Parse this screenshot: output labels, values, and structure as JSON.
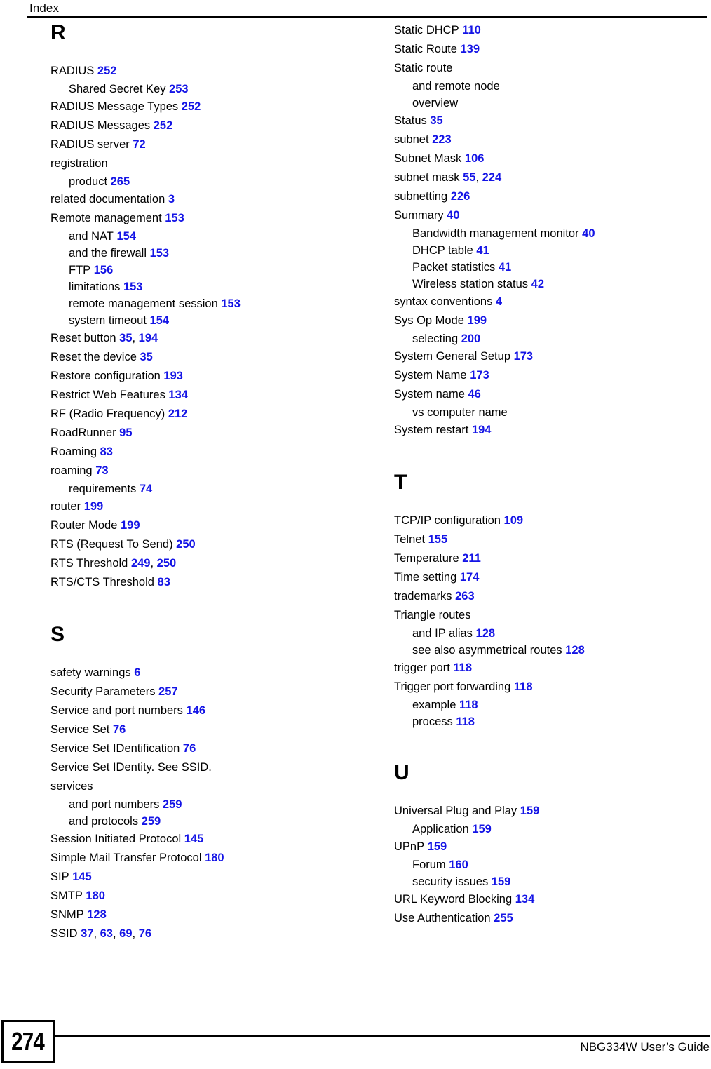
{
  "header": {
    "title": "Index"
  },
  "footer": {
    "page_number": "274",
    "guide_title": "NBG334W User’s Guide"
  },
  "colors": {
    "page_reference": "#1414E6",
    "text": "#000000",
    "background": "#FFFFFF",
    "rule": "#000000"
  },
  "columns": [
    {
      "id": "left",
      "sections": [
        {
          "letter": "R",
          "entries": [
            {
              "level": 1,
              "text": "RADIUS",
              "refs": [
                "252"
              ]
            },
            {
              "level": 2,
              "text": "Shared Secret Key",
              "refs": [
                "253"
              ]
            },
            {
              "level": 1,
              "text": "RADIUS Message Types",
              "refs": [
                "252"
              ]
            },
            {
              "level": 1,
              "text": "RADIUS Messages",
              "refs": [
                "252"
              ]
            },
            {
              "level": 1,
              "text": "RADIUS server",
              "refs": [
                "72"
              ]
            },
            {
              "level": 1,
              "text": "registration",
              "refs": []
            },
            {
              "level": 2,
              "text": "product",
              "refs": [
                "265"
              ]
            },
            {
              "level": 1,
              "text": "related documentation",
              "refs": [
                "3"
              ]
            },
            {
              "level": 1,
              "text": "Remote management",
              "refs": [
                "153"
              ]
            },
            {
              "level": 2,
              "text": "and NAT",
              "refs": [
                "154"
              ]
            },
            {
              "level": 2,
              "text": "and the firewall",
              "refs": [
                "153"
              ]
            },
            {
              "level": 2,
              "text": "FTP",
              "refs": [
                "156"
              ]
            },
            {
              "level": 2,
              "text": "limitations",
              "refs": [
                "153"
              ]
            },
            {
              "level": 2,
              "text": "remote management session",
              "refs": [
                "153"
              ]
            },
            {
              "level": 2,
              "text": "system timeout",
              "refs": [
                "154"
              ]
            },
            {
              "level": 1,
              "text": "Reset button",
              "refs": [
                "35",
                "194"
              ]
            },
            {
              "level": 1,
              "text": "Reset the device",
              "refs": [
                "35"
              ]
            },
            {
              "level": 1,
              "text": "Restore configuration",
              "refs": [
                "193"
              ]
            },
            {
              "level": 1,
              "text": "Restrict Web Features",
              "refs": [
                "134"
              ]
            },
            {
              "level": 1,
              "text": "RF (Radio Frequency)",
              "refs": [
                "212"
              ]
            },
            {
              "level": 1,
              "text": "RoadRunner",
              "refs": [
                "95"
              ]
            },
            {
              "level": 1,
              "text": "Roaming",
              "refs": [
                "83"
              ]
            },
            {
              "level": 1,
              "text": "roaming",
              "refs": [
                "73"
              ]
            },
            {
              "level": 2,
              "text": "requirements",
              "refs": [
                "74"
              ]
            },
            {
              "level": 1,
              "text": "router",
              "refs": [
                "199"
              ]
            },
            {
              "level": 1,
              "text": "Router Mode",
              "refs": [
                "199"
              ]
            },
            {
              "level": 1,
              "text": "RTS (Request To Send)",
              "refs": [
                "250"
              ]
            },
            {
              "level": 1,
              "text": "RTS Threshold",
              "refs": [
                "249",
                "250"
              ]
            },
            {
              "level": 1,
              "text": "RTS/CTS Threshold",
              "refs": [
                "83"
              ]
            }
          ]
        },
        {
          "letter": "S",
          "entries": [
            {
              "level": 1,
              "text": "safety warnings",
              "refs": [
                "6"
              ]
            },
            {
              "level": 1,
              "text": "Security Parameters",
              "refs": [
                "257"
              ]
            },
            {
              "level": 1,
              "text": "Service and port numbers",
              "refs": [
                "146"
              ]
            },
            {
              "level": 1,
              "text": "Service Set",
              "refs": [
                "76"
              ]
            },
            {
              "level": 1,
              "text": "Service Set IDentification",
              "refs": [
                "76"
              ]
            },
            {
              "level": 1,
              "text": "Service Set IDentity. See SSID.",
              "refs": []
            },
            {
              "level": 1,
              "text": "services",
              "refs": []
            },
            {
              "level": 2,
              "text": "and port numbers",
              "refs": [
                "259"
              ]
            },
            {
              "level": 2,
              "text": "and protocols",
              "refs": [
                "259"
              ]
            },
            {
              "level": 1,
              "text": "Session Initiated Protocol",
              "refs": [
                "145"
              ]
            },
            {
              "level": 1,
              "text": "Simple Mail Transfer Protocol",
              "refs": [
                "180"
              ]
            },
            {
              "level": 1,
              "text": "SIP",
              "refs": [
                "145"
              ]
            },
            {
              "level": 1,
              "text": "SMTP",
              "refs": [
                "180"
              ]
            },
            {
              "level": 1,
              "text": "SNMP",
              "refs": [
                "128"
              ]
            },
            {
              "level": 1,
              "text": "SSID",
              "refs": [
                "37",
                "63",
                "69",
                "76"
              ]
            }
          ]
        }
      ]
    },
    {
      "id": "right",
      "sections": [
        {
          "letter": "",
          "entries": [
            {
              "level": 1,
              "text": "Static DHCP",
              "refs": [
                "110"
              ]
            },
            {
              "level": 1,
              "text": "Static Route",
              "refs": [
                "139"
              ]
            },
            {
              "level": 1,
              "text": "Static route",
              "refs": []
            },
            {
              "level": 2,
              "text": "and remote node",
              "refs": []
            },
            {
              "level": 2,
              "text": "overview",
              "refs": []
            },
            {
              "level": 1,
              "text": "Status",
              "refs": [
                "35"
              ]
            },
            {
              "level": 1,
              "text": "subnet",
              "refs": [
                "223"
              ]
            },
            {
              "level": 1,
              "text": "Subnet Mask",
              "refs": [
                "106"
              ]
            },
            {
              "level": 1,
              "text": "subnet mask",
              "refs": [
                "55",
                "224"
              ]
            },
            {
              "level": 1,
              "text": "subnetting",
              "refs": [
                "226"
              ]
            },
            {
              "level": 1,
              "text": "Summary",
              "refs": [
                "40"
              ]
            },
            {
              "level": 2,
              "text": "Bandwidth management monitor",
              "refs": [
                "40"
              ]
            },
            {
              "level": 2,
              "text": "DHCP table",
              "refs": [
                "41"
              ]
            },
            {
              "level": 2,
              "text": "Packet statistics",
              "refs": [
                "41"
              ]
            },
            {
              "level": 2,
              "text": "Wireless station status",
              "refs": [
                "42"
              ]
            },
            {
              "level": 1,
              "text": "syntax conventions",
              "refs": [
                "4"
              ]
            },
            {
              "level": 1,
              "text": "Sys Op Mode",
              "refs": [
                "199"
              ]
            },
            {
              "level": 2,
              "text": "selecting",
              "refs": [
                "200"
              ]
            },
            {
              "level": 1,
              "text": "System General Setup",
              "refs": [
                "173"
              ]
            },
            {
              "level": 1,
              "text": "System Name",
              "refs": [
                "173"
              ]
            },
            {
              "level": 1,
              "text": "System name",
              "refs": [
                "46"
              ]
            },
            {
              "level": 2,
              "text": "vs computer name",
              "refs": []
            },
            {
              "level": 1,
              "text": "System restart",
              "refs": [
                "194"
              ]
            }
          ]
        },
        {
          "letter": "T",
          "entries": [
            {
              "level": 1,
              "text": "TCP/IP configuration",
              "refs": [
                "109"
              ]
            },
            {
              "level": 1,
              "text": "Telnet",
              "refs": [
                "155"
              ]
            },
            {
              "level": 1,
              "text": "Temperature",
              "refs": [
                "211"
              ]
            },
            {
              "level": 1,
              "text": "Time setting",
              "refs": [
                "174"
              ]
            },
            {
              "level": 1,
              "text": "trademarks",
              "refs": [
                "263"
              ]
            },
            {
              "level": 1,
              "text": "Triangle routes",
              "refs": []
            },
            {
              "level": 2,
              "text": "and IP alias",
              "refs": [
                "128"
              ]
            },
            {
              "level": 2,
              "text": "see also asymmetrical routes",
              "refs": [
                "128"
              ]
            },
            {
              "level": 1,
              "text": "trigger port",
              "refs": [
                "118"
              ]
            },
            {
              "level": 1,
              "text": "Trigger port forwarding",
              "refs": [
                "118"
              ]
            },
            {
              "level": 2,
              "text": "example",
              "refs": [
                "118"
              ]
            },
            {
              "level": 2,
              "text": "process",
              "refs": [
                "118"
              ]
            }
          ]
        },
        {
          "letter": "U",
          "entries": [
            {
              "level": 1,
              "text": "Universal Plug and Play",
              "refs": [
                "159"
              ]
            },
            {
              "level": 2,
              "text": "Application",
              "refs": [
                "159"
              ]
            },
            {
              "level": 1,
              "text": "UPnP",
              "refs": [
                "159"
              ]
            },
            {
              "level": 2,
              "text": "Forum",
              "refs": [
                "160"
              ]
            },
            {
              "level": 2,
              "text": "security issues",
              "refs": [
                "159"
              ]
            },
            {
              "level": 1,
              "text": "URL Keyword Blocking",
              "refs": [
                "134"
              ]
            },
            {
              "level": 1,
              "text": "Use Authentication",
              "refs": [
                "255"
              ]
            }
          ]
        }
      ]
    }
  ]
}
